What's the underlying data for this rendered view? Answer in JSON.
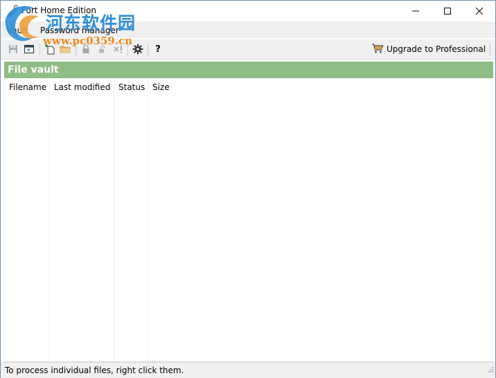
{
  "window": {
    "title": "Fort Home Edition"
  },
  "watermark": {
    "chinese": "河东软件园",
    "url": "www.pc0359.cn"
  },
  "menu": {
    "items": [
      "Vault",
      "Password manager"
    ]
  },
  "toolbar": {
    "icons": [
      "save-icon",
      "open-vault-icon",
      "new-file-icon",
      "folder-icon",
      "lock-icon",
      "unlock-icon",
      "delete-icon",
      "settings-icon",
      "help-icon"
    ],
    "help_label": "?",
    "upgrade_label": "Upgrade to Professional"
  },
  "vault": {
    "title": "File vault",
    "columns": [
      "Filename",
      "Last modified",
      "Status",
      "Size"
    ],
    "rows": []
  },
  "status": {
    "text": "To process individual files, right click them."
  },
  "colors": {
    "header_green": "#8fbd86",
    "chrome_gray": "#f0f0f0"
  }
}
